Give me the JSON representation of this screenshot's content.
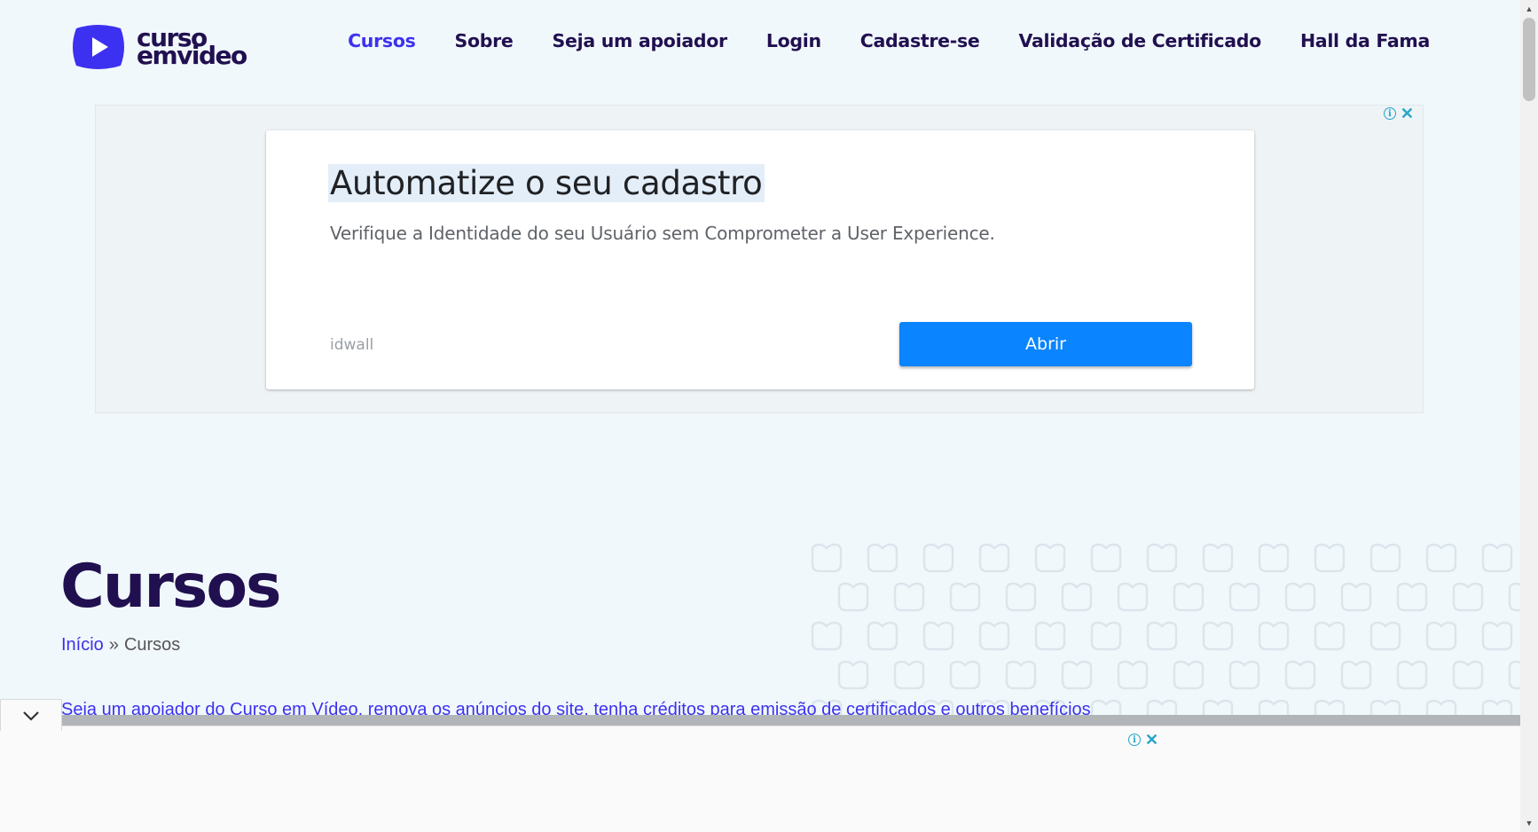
{
  "site": {
    "logo_line1": "curso",
    "logo_line2": "emvideo",
    "brand_color": "#3c31f0",
    "dark_color": "#211050"
  },
  "nav": {
    "items": [
      {
        "label": "Cursos",
        "active": true
      },
      {
        "label": "Sobre",
        "active": false
      },
      {
        "label": "Seja um apoiador",
        "active": false
      },
      {
        "label": "Login",
        "active": false
      },
      {
        "label": "Cadastre-se",
        "active": false
      },
      {
        "label": "Validação de Certificado",
        "active": false
      },
      {
        "label": "Hall da Fama",
        "active": false
      }
    ]
  },
  "ad_top": {
    "headline": "Automatize o seu cadastro",
    "description": "Verifique a Identidade do seu Usuário sem Comprometer a User Experience.",
    "advertiser": "idwall",
    "cta": "Abrir",
    "info_icon": "i",
    "close_icon": "✕",
    "cta_color": "#0a84ff"
  },
  "page": {
    "title": "Cursos",
    "breadcrumb": {
      "home": "Início",
      "separator": "»",
      "current": "Cursos"
    },
    "support_link": "Seja um apoiador do Curso em Vídeo, remova os anúncios do site, tenha créditos para emissão de certificados e outros benefícios"
  },
  "ad_bottom": {
    "info_icon": "i",
    "close_icon": "✕"
  },
  "scrollbar": {
    "up_arrow": "▲",
    "down_arrow": "▼"
  }
}
